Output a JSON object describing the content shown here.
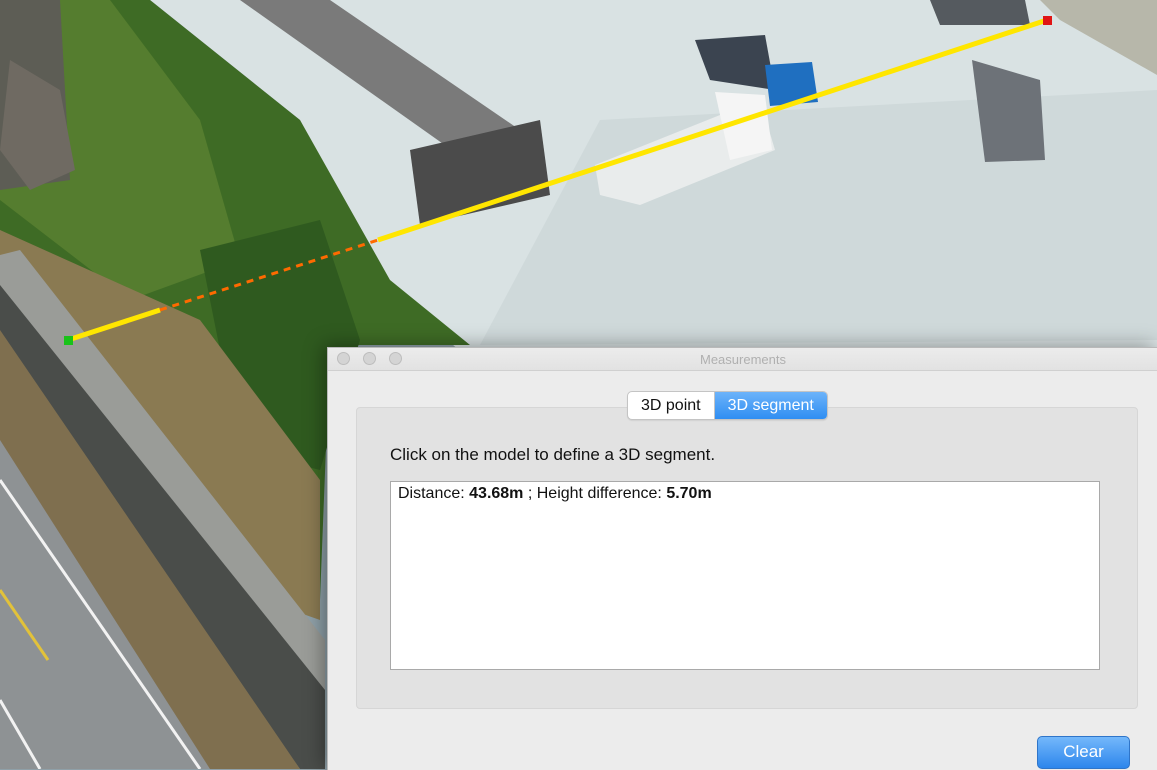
{
  "window": {
    "title": "Measurements"
  },
  "tabs": [
    {
      "label": "3D point",
      "active": false
    },
    {
      "label": "3D segment",
      "active": true
    }
  ],
  "instruction": "Click on the model to define a 3D segment.",
  "result": {
    "distance_label": "Distance: ",
    "distance_value": "43.68m",
    "separator": " ; Height difference: ",
    "height_value": "5.70m"
  },
  "buttons": {
    "clear": "Clear"
  },
  "colors": {
    "segment_solid": "#ffe600",
    "segment_dashed": "#ff6a00",
    "start_point": "#19c219",
    "end_point": "#e01414",
    "accent": "#2f8ef2"
  }
}
